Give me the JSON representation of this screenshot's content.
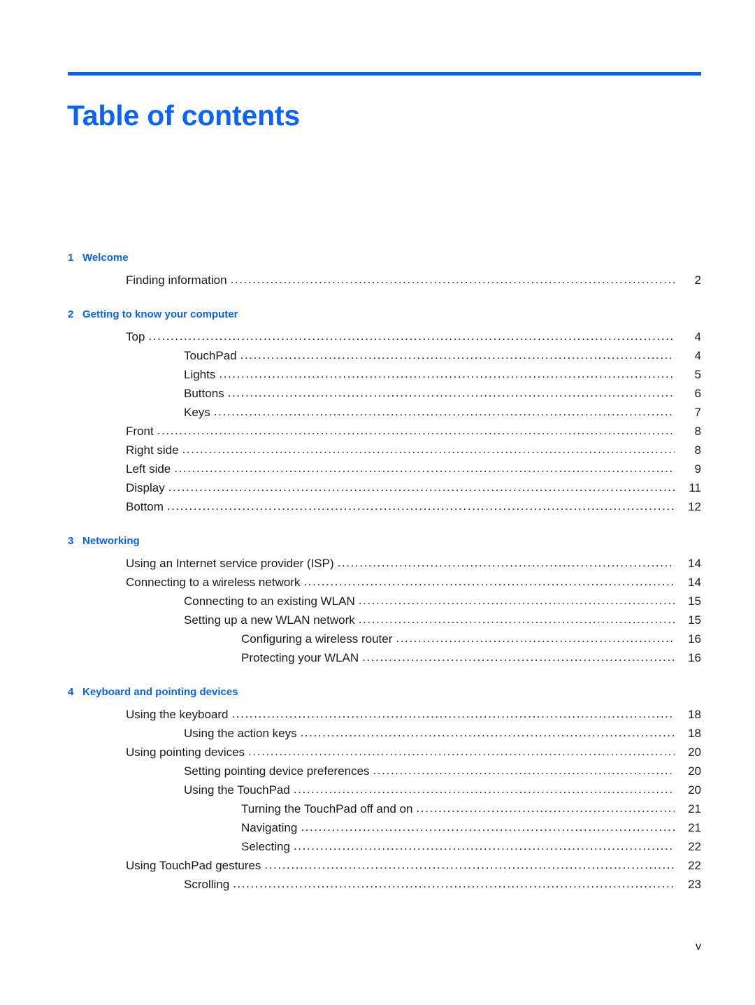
{
  "document": {
    "title": "Table of contents",
    "accent_color": "#0a63f5",
    "folio": "v"
  },
  "toc": {
    "chapters": [
      {
        "number": "1",
        "title": "Welcome",
        "entries": [
          {
            "level": 1,
            "label": "Finding information",
            "page": "2"
          }
        ]
      },
      {
        "number": "2",
        "title": "Getting to know your computer",
        "entries": [
          {
            "level": 1,
            "label": "Top",
            "page": "4"
          },
          {
            "level": 2,
            "label": "TouchPad",
            "page": "4"
          },
          {
            "level": 2,
            "label": "Lights",
            "page": "5"
          },
          {
            "level": 2,
            "label": "Buttons",
            "page": "6"
          },
          {
            "level": 2,
            "label": "Keys",
            "page": "7"
          },
          {
            "level": 1,
            "label": "Front",
            "page": "8"
          },
          {
            "level": 1,
            "label": "Right side",
            "page": "8"
          },
          {
            "level": 1,
            "label": "Left side",
            "page": "9"
          },
          {
            "level": 1,
            "label": "Display",
            "page": "11"
          },
          {
            "level": 1,
            "label": "Bottom",
            "page": "12"
          }
        ]
      },
      {
        "number": "3",
        "title": "Networking",
        "entries": [
          {
            "level": 1,
            "label": "Using an Internet service provider (ISP)",
            "page": "14"
          },
          {
            "level": 1,
            "label": "Connecting to a wireless network",
            "page": "14"
          },
          {
            "level": 2,
            "label": "Connecting to an existing WLAN",
            "page": "15"
          },
          {
            "level": 2,
            "label": "Setting up a new WLAN network",
            "page": "15"
          },
          {
            "level": 3,
            "label": "Configuring a wireless router",
            "page": "16"
          },
          {
            "level": 3,
            "label": "Protecting your WLAN",
            "page": "16"
          }
        ]
      },
      {
        "number": "4",
        "title": "Keyboard and pointing devices",
        "entries": [
          {
            "level": 1,
            "label": "Using the keyboard",
            "page": "18"
          },
          {
            "level": 2,
            "label": "Using the action keys",
            "page": "18"
          },
          {
            "level": 1,
            "label": "Using pointing devices",
            "page": "20"
          },
          {
            "level": 2,
            "label": "Setting pointing device preferences",
            "page": "20"
          },
          {
            "level": 2,
            "label": "Using the TouchPad",
            "page": "20"
          },
          {
            "level": 3,
            "label": "Turning the TouchPad off and on",
            "page": "21"
          },
          {
            "level": 3,
            "label": "Navigating",
            "page": "21"
          },
          {
            "level": 3,
            "label": "Selecting",
            "page": "22"
          },
          {
            "level": 1,
            "label": "Using TouchPad gestures",
            "page": "22"
          },
          {
            "level": 2,
            "label": "Scrolling",
            "page": "23"
          }
        ]
      }
    ]
  }
}
